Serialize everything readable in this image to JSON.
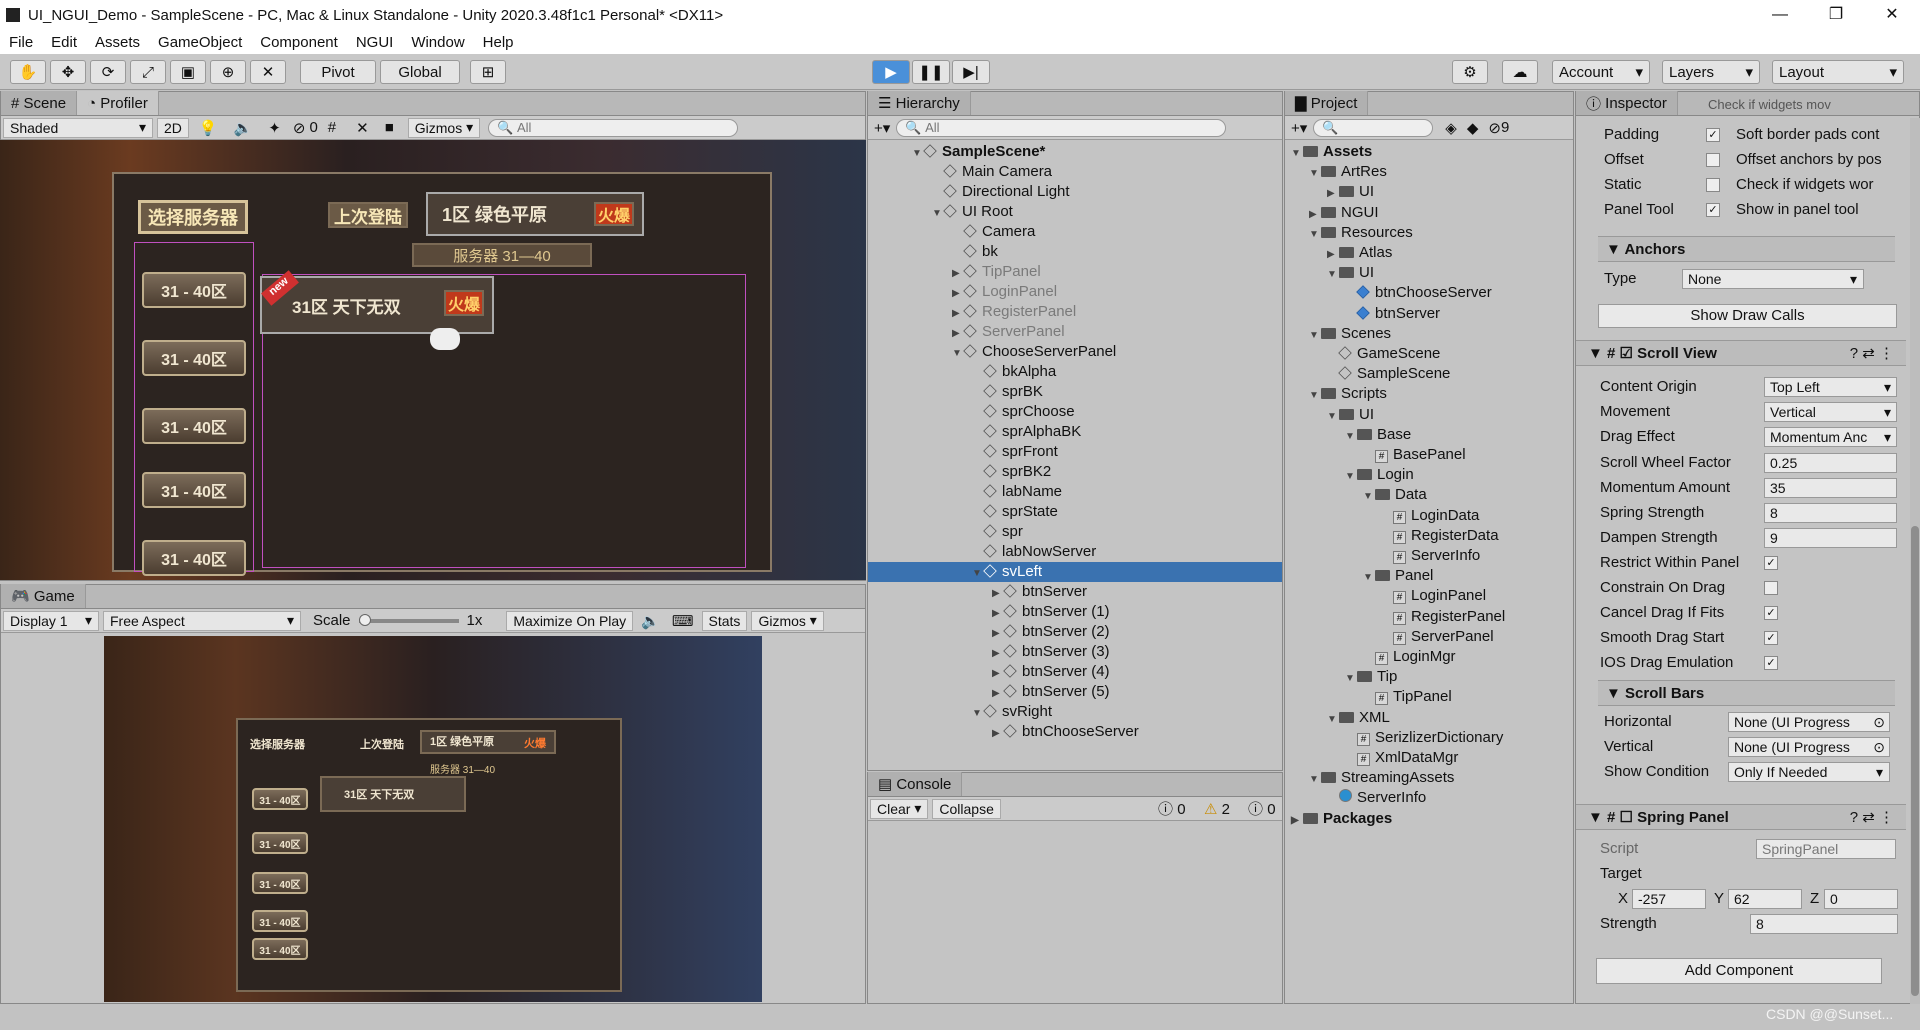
{
  "window": {
    "title": "UI_NGUI_Demo - SampleScene - PC, Mac & Linux Standalone - Unity 2020.3.48f1c1 Personal* <DX11>",
    "minimize": "—",
    "restore": "❐",
    "close": "✕"
  },
  "menu": [
    "File",
    "Edit",
    "Assets",
    "GameObject",
    "Component",
    "NGUI",
    "Window",
    "Help"
  ],
  "toolbar": {
    "pivot": "Pivot",
    "global": "Global",
    "account": "Account",
    "layers": "Layers",
    "layout": "Layout",
    "play": "▶",
    "pause": "❚❚",
    "step": "▶|"
  },
  "scene": {
    "tab_scene": "Scene",
    "tab_profiler": "Profiler",
    "shaded": "Shaded",
    "mode2d": "2D",
    "zero": "0",
    "gizmos": "Gizmos",
    "search": "All"
  },
  "game": {
    "tab": "Game",
    "display": "Display 1",
    "aspect": "Free Aspect",
    "scale": "Scale",
    "scale_value": "1x",
    "maximize": "Maximize On Play",
    "stats": "Stats",
    "gizmos": "Gizmos"
  },
  "gameui": {
    "title": "选择服务器",
    "last_login": "上次登陆",
    "zone": "1区 绿色平原",
    "hot": "火爆",
    "range": "服务器 31—40",
    "server_item": "31区  天下无双",
    "new": "new",
    "btn_label": "31 - 40区"
  },
  "hierarchy": {
    "tab": "Hierarchy",
    "search": "All",
    "rows": [
      {
        "label": "SampleScene*",
        "indent": 0,
        "arrow": "▼",
        "bold": true
      },
      {
        "label": "Main Camera",
        "indent": 1,
        "arrow": ""
      },
      {
        "label": "Directional Light",
        "indent": 1,
        "arrow": ""
      },
      {
        "label": "UI Root",
        "indent": 1,
        "arrow": "▼"
      },
      {
        "label": "Camera",
        "indent": 2,
        "arrow": ""
      },
      {
        "label": "bk",
        "indent": 2,
        "arrow": ""
      },
      {
        "label": "TipPanel",
        "indent": 2,
        "arrow": "▶",
        "dim": true
      },
      {
        "label": "LoginPanel",
        "indent": 2,
        "arrow": "▶",
        "dim": true
      },
      {
        "label": "RegisterPanel",
        "indent": 2,
        "arrow": "▶",
        "dim": true
      },
      {
        "label": "ServerPanel",
        "indent": 2,
        "arrow": "▶",
        "dim": true
      },
      {
        "label": "ChooseServerPanel",
        "indent": 2,
        "arrow": "▼"
      },
      {
        "label": "bkAlpha",
        "indent": 3,
        "arrow": ""
      },
      {
        "label": "sprBK",
        "indent": 3,
        "arrow": ""
      },
      {
        "label": "sprChoose",
        "indent": 3,
        "arrow": ""
      },
      {
        "label": "sprAlphaBK",
        "indent": 3,
        "arrow": ""
      },
      {
        "label": "sprFront",
        "indent": 3,
        "arrow": ""
      },
      {
        "label": "sprBK2",
        "indent": 3,
        "arrow": ""
      },
      {
        "label": "labName",
        "indent": 3,
        "arrow": ""
      },
      {
        "label": "sprState",
        "indent": 3,
        "arrow": ""
      },
      {
        "label": "spr",
        "indent": 3,
        "arrow": ""
      },
      {
        "label": "labNowServer",
        "indent": 3,
        "arrow": ""
      },
      {
        "label": "svLeft",
        "indent": 3,
        "arrow": "▼",
        "selected": true
      },
      {
        "label": "btnServer",
        "indent": 4,
        "arrow": "▶"
      },
      {
        "label": "btnServer (1)",
        "indent": 4,
        "arrow": "▶"
      },
      {
        "label": "btnServer (2)",
        "indent": 4,
        "arrow": "▶"
      },
      {
        "label": "btnServer (3)",
        "indent": 4,
        "arrow": "▶"
      },
      {
        "label": "btnServer (4)",
        "indent": 4,
        "arrow": "▶"
      },
      {
        "label": "btnServer (5)",
        "indent": 4,
        "arrow": "▶"
      },
      {
        "label": "svRight",
        "indent": 3,
        "arrow": "▼"
      },
      {
        "label": "btnChooseServer",
        "indent": 4,
        "arrow": "▶"
      }
    ]
  },
  "console": {
    "tab": "Console",
    "clear": "Clear",
    "collapse": "Collapse",
    "info": "0",
    "warn": "2",
    "error": "0"
  },
  "project": {
    "tab": "Project",
    "count": "9",
    "rows": [
      {
        "label": "Assets",
        "indent": 0,
        "arrow": "▼",
        "type": "folder",
        "bold": true
      },
      {
        "label": "ArtRes",
        "indent": 1,
        "arrow": "▼",
        "type": "folder"
      },
      {
        "label": "UI",
        "indent": 2,
        "arrow": "▶",
        "type": "folder"
      },
      {
        "label": "NGUI",
        "indent": 1,
        "arrow": "▶",
        "type": "folder"
      },
      {
        "label": "Resources",
        "indent": 1,
        "arrow": "▼",
        "type": "folder"
      },
      {
        "label": "Atlas",
        "indent": 2,
        "arrow": "▶",
        "type": "folder"
      },
      {
        "label": "UI",
        "indent": 2,
        "arrow": "▼",
        "type": "folder"
      },
      {
        "label": "btnChooseServer",
        "indent": 3,
        "arrow": "",
        "type": "prefab"
      },
      {
        "label": "btnServer",
        "indent": 3,
        "arrow": "",
        "type": "prefab"
      },
      {
        "label": "Scenes",
        "indent": 1,
        "arrow": "▼",
        "type": "folder"
      },
      {
        "label": "GameScene",
        "indent": 2,
        "arrow": "",
        "type": "scene"
      },
      {
        "label": "SampleScene",
        "indent": 2,
        "arrow": "",
        "type": "scene"
      },
      {
        "label": "Scripts",
        "indent": 1,
        "arrow": "▼",
        "type": "folder"
      },
      {
        "label": "UI",
        "indent": 2,
        "arrow": "▼",
        "type": "folder"
      },
      {
        "label": "Base",
        "indent": 3,
        "arrow": "▼",
        "type": "folder"
      },
      {
        "label": "BasePanel",
        "indent": 4,
        "arrow": "",
        "type": "script"
      },
      {
        "label": "Login",
        "indent": 3,
        "arrow": "▼",
        "type": "folder"
      },
      {
        "label": "Data",
        "indent": 4,
        "arrow": "▼",
        "type": "folder"
      },
      {
        "label": "LoginData",
        "indent": 5,
        "arrow": "",
        "type": "script"
      },
      {
        "label": "RegisterData",
        "indent": 5,
        "arrow": "",
        "type": "script"
      },
      {
        "label": "ServerInfo",
        "indent": 5,
        "arrow": "",
        "type": "script"
      },
      {
        "label": "Panel",
        "indent": 4,
        "arrow": "▼",
        "type": "folder"
      },
      {
        "label": "LoginPanel",
        "indent": 5,
        "arrow": "",
        "type": "script"
      },
      {
        "label": "RegisterPanel",
        "indent": 5,
        "arrow": "",
        "type": "script"
      },
      {
        "label": "ServerPanel",
        "indent": 5,
        "arrow": "",
        "type": "script"
      },
      {
        "label": "LoginMgr",
        "indent": 4,
        "arrow": "",
        "type": "script"
      },
      {
        "label": "Tip",
        "indent": 3,
        "arrow": "▼",
        "type": "folder"
      },
      {
        "label": "TipPanel",
        "indent": 4,
        "arrow": "",
        "type": "script"
      },
      {
        "label": "XML",
        "indent": 2,
        "arrow": "▼",
        "type": "folder"
      },
      {
        "label": "SerizlizerDictionary",
        "indent": 3,
        "arrow": "",
        "type": "script"
      },
      {
        "label": "XmlDataMgr",
        "indent": 3,
        "arrow": "",
        "type": "script"
      },
      {
        "label": "StreamingAssets",
        "indent": 1,
        "arrow": "▼",
        "type": "folder"
      },
      {
        "label": "ServerInfo",
        "indent": 2,
        "arrow": "",
        "type": "asset"
      },
      {
        "label": "Packages",
        "indent": 0,
        "arrow": "▶",
        "type": "folder",
        "bold": true
      }
    ]
  },
  "inspector": {
    "tab": "Inspector",
    "top_cut": "Check if widgets mov",
    "padding": "Padding",
    "padding_desc": "Soft border pads cont",
    "offset": "Offset",
    "offset_desc": "Offset anchors by pos",
    "static": "Static",
    "static_desc": "Check if widgets wor",
    "panel_tool": "Panel Tool",
    "panel_tool_desc": "Show in panel tool",
    "anchors": "Anchors",
    "type": "Type",
    "type_value": "None",
    "show_draw_calls": "Show Draw Calls",
    "scroll_view": "Scroll View",
    "content_origin": "Content Origin",
    "content_origin_value": "Top Left",
    "movement": "Movement",
    "movement_value": "Vertical",
    "drag_effect": "Drag Effect",
    "drag_effect_value": "Momentum Anc",
    "scroll_wheel": "Scroll Wheel Factor",
    "scroll_wheel_value": "0.25",
    "momentum": "Momentum Amount",
    "momentum_value": "35",
    "spring": "Spring Strength",
    "spring_value": "8",
    "dampen": "Dampen Strength",
    "dampen_value": "9",
    "restrict": "Restrict Within Panel",
    "constrain": "Constrain On Drag",
    "cancel_drag": "Cancel Drag If Fits",
    "smooth_drag": "Smooth Drag Start",
    "ios_drag": "IOS Drag Emulation",
    "scroll_bars": "Scroll Bars",
    "horizontal": "Horizontal",
    "horizontal_value": "None (UI Progress",
    "vertical": "Vertical",
    "vertical_value": "None (UI Progress",
    "show_condition": "Show Condition",
    "show_condition_value": "Only If Needed",
    "spring_panel": "Spring Panel",
    "script": "Script",
    "script_value": "SpringPanel",
    "target": "Target",
    "x": "X",
    "x_value": "-257",
    "y": "Y",
    "y_value": "62",
    "z": "Z",
    "z_value": "0",
    "strength": "Strength",
    "strength_value": "8",
    "add_component": "Add Component"
  },
  "watermark": "CSDN @@Sunset..."
}
